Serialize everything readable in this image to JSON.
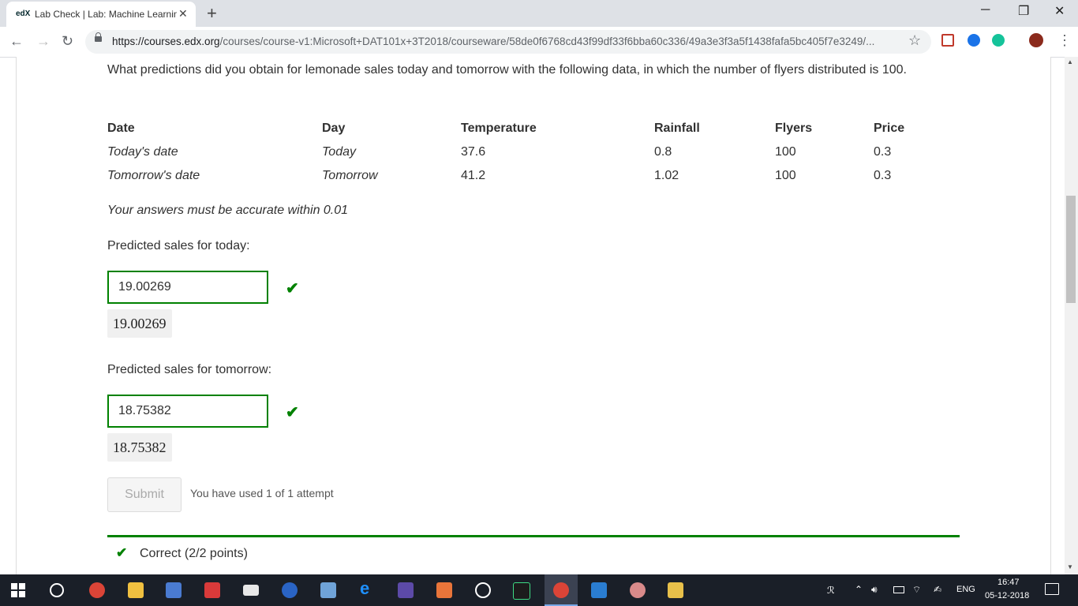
{
  "browser": {
    "tab_title": "Lab Check | Lab: Machine Learning",
    "favicon_text": "edX",
    "url_host": "https://courses.edx.org",
    "url_path": "/courses/course-v1:Microsoft+DAT101x+3T2018/courseware/58de0f6768cd43f99df33f6bba60c336/49a3e3f3a5f1438fafa5bc405f7e3249/..."
  },
  "question": {
    "text": "What predictions did you obtain for lemonade sales today and tomorrow with the following data, in which the number of flyers distributed is 100."
  },
  "table": {
    "headers": [
      "Date",
      "Day",
      "Temperature",
      "Rainfall",
      "Flyers",
      "Price"
    ],
    "rows": [
      [
        "Today's date",
        "Today",
        "37.6",
        "0.8",
        "100",
        "0.3"
      ],
      [
        "Tomorrow's date",
        "Tomorrow",
        "41.2",
        "1.02",
        "100",
        "0.3"
      ]
    ]
  },
  "note": "Your answers must be accurate within 0.01",
  "today": {
    "label": "Predicted sales for today:",
    "value": "19.00269",
    "preview": "19.00269"
  },
  "tomorrow": {
    "label": "Predicted sales for tomorrow:",
    "value": "18.75382",
    "preview": "18.75382"
  },
  "submit_label": "Submit",
  "attempt_text": "You have used 1 of 1 attempt",
  "result_text": "Correct (2/2 points)",
  "taskbar": {
    "lang": "ENG",
    "time": "16:47",
    "date": "05-12-2018"
  },
  "colors": {
    "correct": "#008100",
    "taskbar": "#1a1f28"
  }
}
